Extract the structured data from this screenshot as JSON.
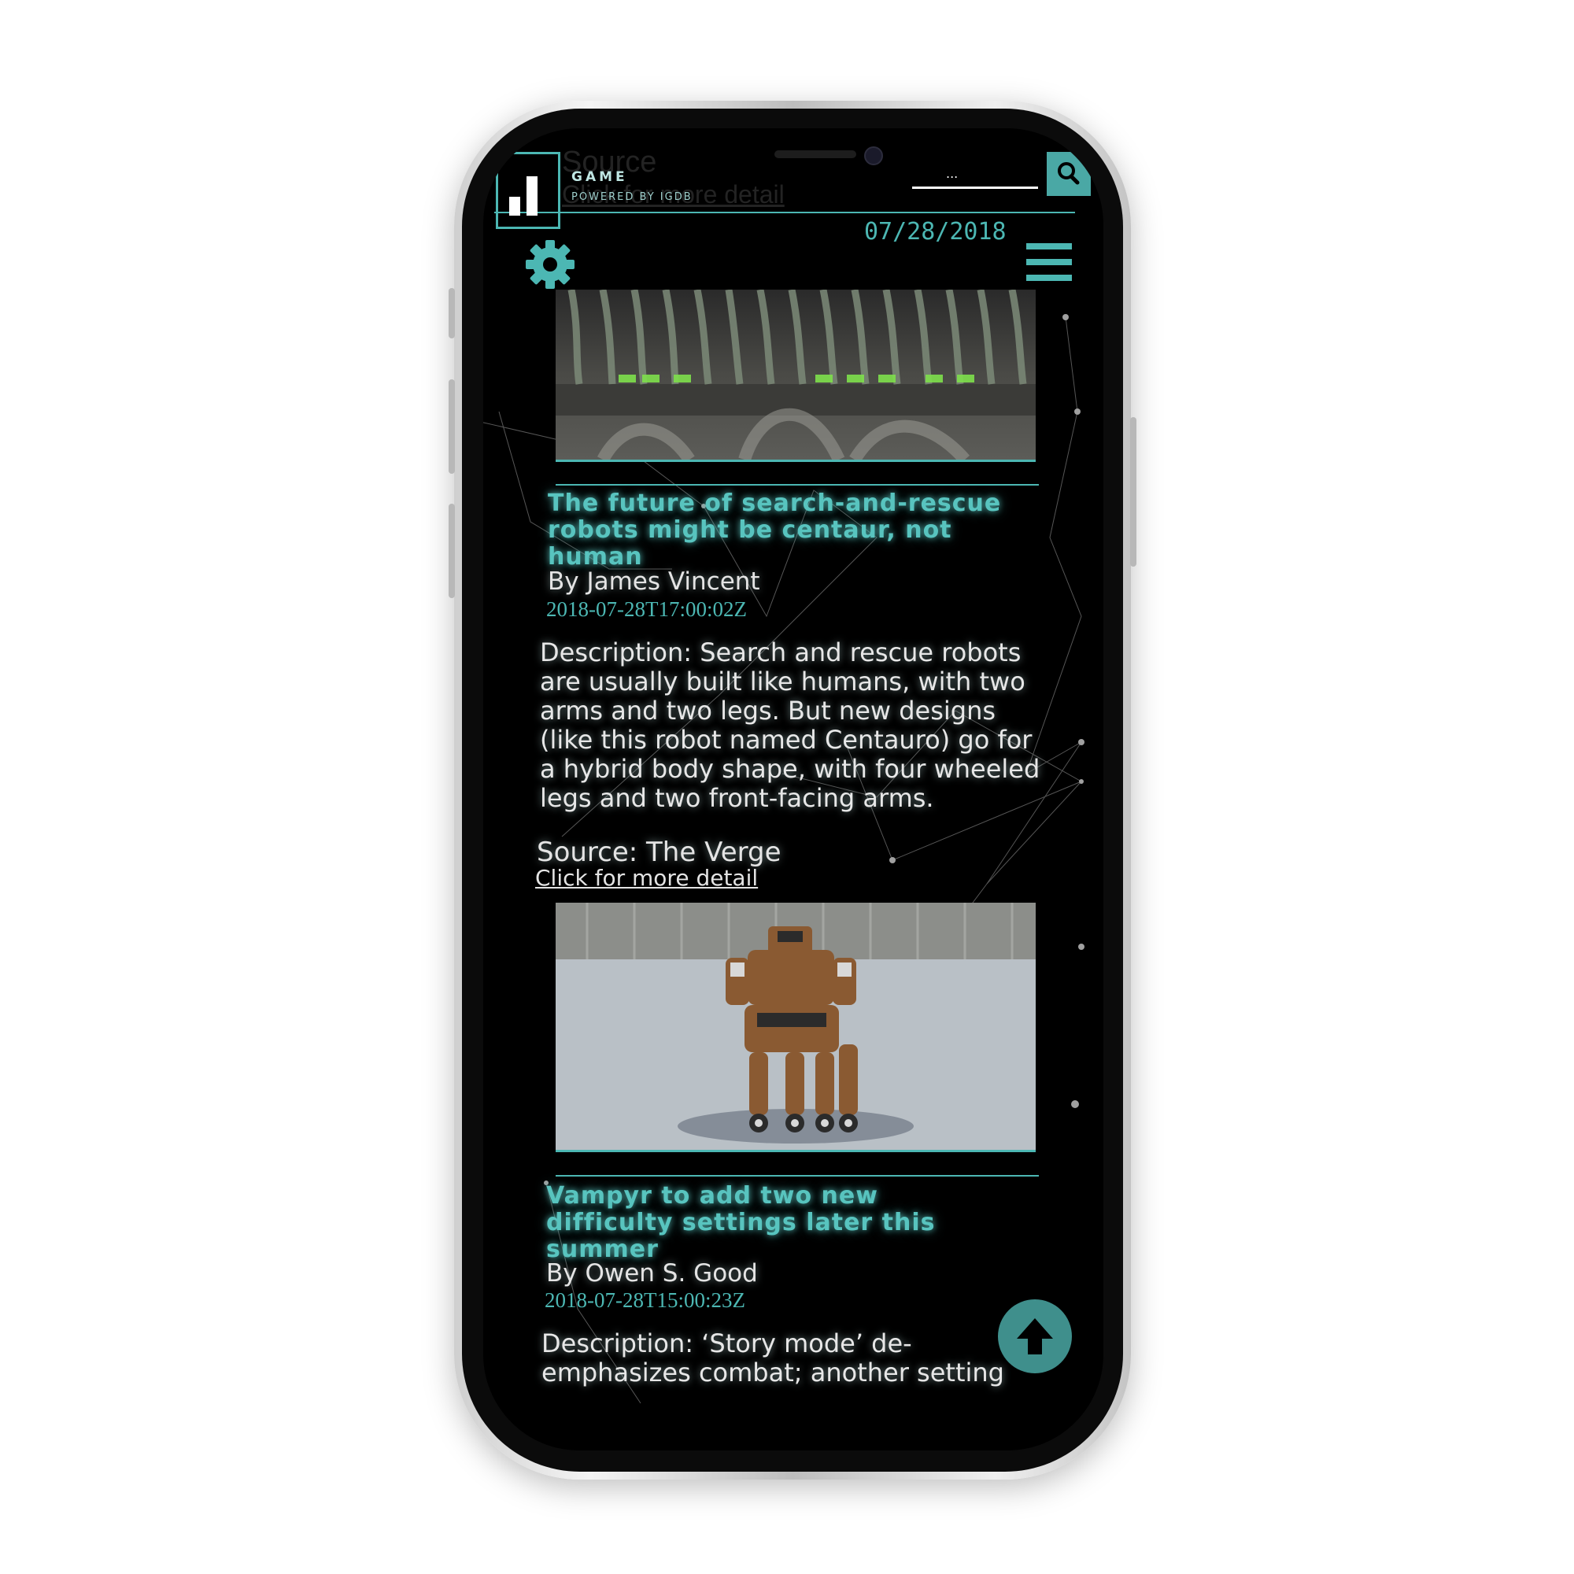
{
  "app": {
    "brand": "GAME",
    "powered_by": "POWERED BY IGDB",
    "date": "07/28/2018",
    "search": {
      "placeholder": "..."
    },
    "ghost_source": "Source",
    "ghost_link": "Click for more detail"
  },
  "articles": [
    {
      "title": "The future of search-and-rescue robots might be centaur, not human",
      "author": "By James Vincent",
      "published": "2018-07-28T17:00:02Z",
      "description": "Description: Search and rescue robots are usually built like humans, with two arms and two legs. But new designs (like this robot named Centauro) go for a hybrid body shape, with four wheeled legs and two front-facing arms.",
      "source": "Source: The Verge",
      "link": "Click for more detail"
    },
    {
      "title": "Vampyr to add two new difficulty settings later this summer",
      "author": "By Owen S. Good",
      "published": "2018-07-28T15:00:23Z",
      "description": "Description: ‘Story mode’ de-emphasizes combat; another setting"
    }
  ],
  "icons": {
    "search": "search-icon",
    "settings": "gear-icon",
    "menu": "hamburger-menu-icon",
    "scroll_top": "arrow-up-icon"
  },
  "colors": {
    "accent": "#4cb7b3",
    "background": "#000000",
    "text": "#e4e4e4"
  }
}
